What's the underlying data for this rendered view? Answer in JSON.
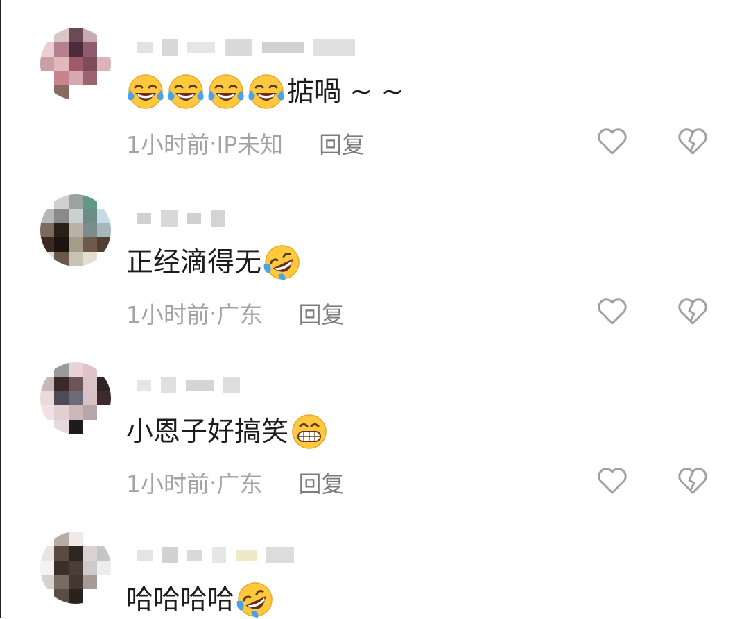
{
  "comments": [
    {
      "text": "掂喎 ~ ~",
      "emoji": "tears-of-joy",
      "emoji_count": 4,
      "emoji_position": "before",
      "time": "1小时前",
      "location": "IP未知",
      "reply_label": "回复"
    },
    {
      "text": "正经滴得无",
      "emoji": "rolling-on-floor-laughing",
      "emoji_count": 1,
      "emoji_position": "after",
      "time": "1小时前",
      "location": "广东",
      "reply_label": "回复"
    },
    {
      "text": "小恩子好搞笑",
      "emoji": "grinning",
      "emoji_count": 1,
      "emoji_position": "after",
      "time": "1小时前",
      "location": "广东",
      "reply_label": "回复"
    },
    {
      "text": "哈哈哈哈",
      "emoji": "rolling-on-floor-laughing",
      "emoji_count": 1,
      "emoji_position": "after",
      "time": "",
      "location": "",
      "reply_label": ""
    }
  ],
  "separator": " · ",
  "colors": {
    "text": "#1c1c1c",
    "meta": "#a3a3a3",
    "reply": "#7c7c7c",
    "icon": "#a0a0a0",
    "emoji_face": "#ffc83d"
  },
  "icons": {
    "like": "heart-outline-icon",
    "dislike": "broken-heart-icon"
  }
}
